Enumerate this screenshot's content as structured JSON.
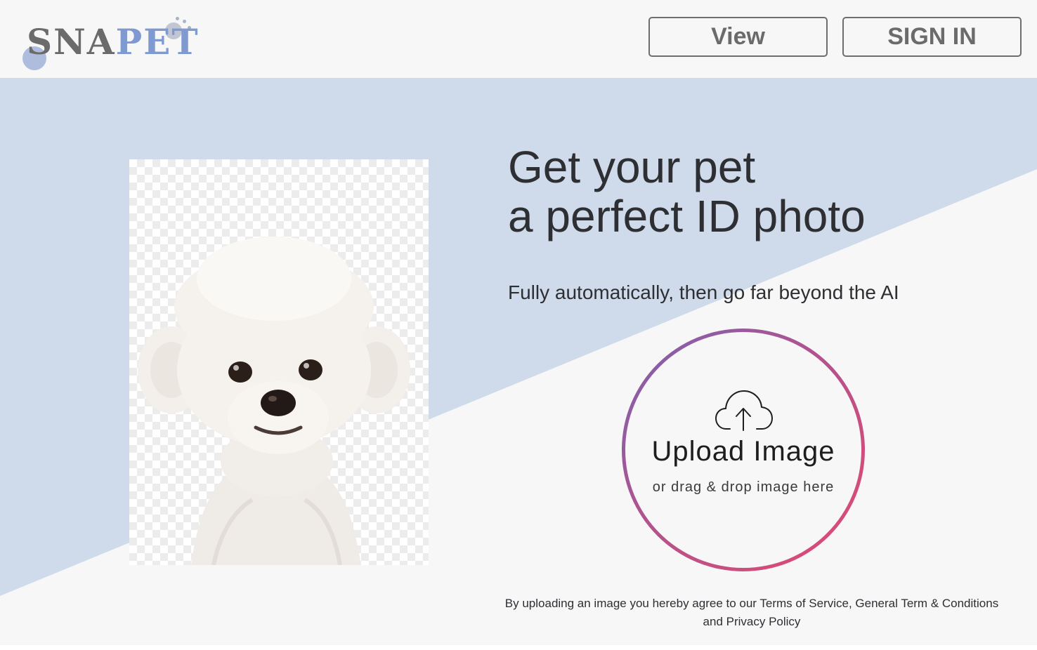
{
  "header": {
    "logo_prefix": "SNA",
    "logo_suffix": "PET",
    "view_label": "View",
    "signin_label": "SIGN IN"
  },
  "hero": {
    "headline_line1": "Get your pet",
    "headline_line2": "a perfect ID photo",
    "subtitle": "Fully automatically, then go far beyond the AI"
  },
  "upload": {
    "title": "Upload Image",
    "subtitle": "or drag & drop image here",
    "icon": "cloud-upload-icon"
  },
  "legal": {
    "line1": "By uploading an image you hereby agree to our Terms of Service, General Term & Conditions",
    "line2": "and Privacy Policy"
  },
  "colors": {
    "header_bg": "#f7f7f7",
    "hero_blue": "#cfdaea",
    "hero_light": "#f7f7f7",
    "logo_gray": "#6b6b6b",
    "logo_blue": "#7e9ad0",
    "ring_start": "#7a63b0",
    "ring_end": "#e34a6f"
  }
}
